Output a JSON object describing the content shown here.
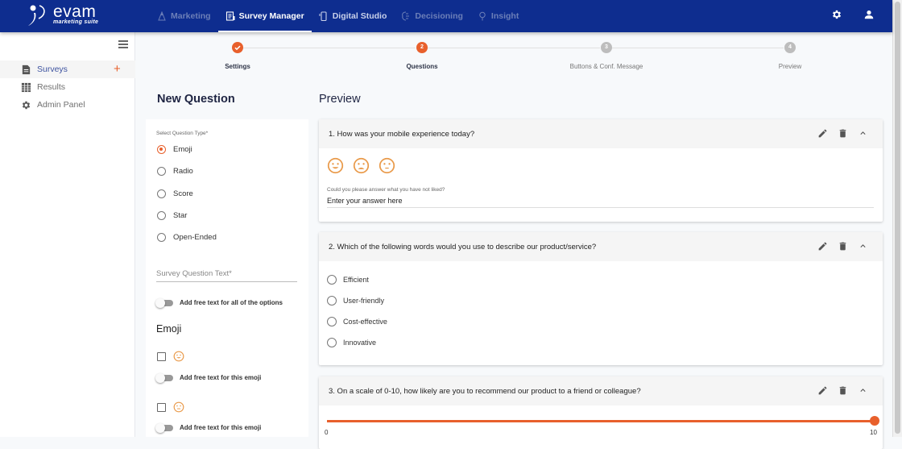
{
  "brand": {
    "name": "evam",
    "tagline": "marketing suite"
  },
  "nav": [
    {
      "label": "Marketing",
      "icon": "marketing-icon",
      "active": false
    },
    {
      "label": "Survey Manager",
      "icon": "survey-icon",
      "active": true
    },
    {
      "label": "Digital Studio",
      "icon": "mobile-icon",
      "active": false
    },
    {
      "label": "Decisioning",
      "icon": "brain-icon",
      "active": false
    },
    {
      "label": "Insight",
      "icon": "bulb-icon",
      "active": false
    }
  ],
  "sidebar": {
    "items": [
      {
        "label": "Surveys",
        "icon": "document-icon",
        "active": true
      },
      {
        "label": "Results",
        "icon": "table-icon",
        "active": false
      },
      {
        "label": "Admin Panel",
        "icon": "gear-icon",
        "active": false
      }
    ],
    "add_symbol": "+"
  },
  "stepper": {
    "steps": [
      {
        "label": "Settings",
        "state": "done",
        "number": "1"
      },
      {
        "label": "Questions",
        "state": "current",
        "number": "2"
      },
      {
        "label": "Buttons & Conf. Message",
        "state": "todo",
        "number": "3"
      },
      {
        "label": "Preview",
        "state": "todo",
        "number": "4"
      }
    ]
  },
  "new_question": {
    "title": "New Question",
    "type_label": "Select Question Type*",
    "types": [
      "Emoji",
      "Radio",
      "Score",
      "Star",
      "Open-Ended"
    ],
    "selected_type": "Emoji",
    "question_text_placeholder": "Survey Question Text*",
    "free_text_all_label": "Add free text for all of the options",
    "emoji_section_title": "Emoji",
    "emoji_options": [
      {
        "emoji": "happy",
        "free_text_label": "Add free text for this emoji"
      },
      {
        "emoji": "neutral",
        "free_text_label": "Add free text for this emoji"
      }
    ]
  },
  "preview": {
    "title": "Preview",
    "questions": [
      {
        "text": "1. How was your mobile experience today?",
        "type": "emoji",
        "emojis": [
          "happy",
          "sad",
          "neutral"
        ],
        "free_text_label": "Could you please answer what you have not liked?",
        "free_text_value": "Enter your answer here"
      },
      {
        "text": "2. Which of the following words would you use to describe our product/service?",
        "type": "radio",
        "options": [
          "Efficient",
          "User-friendly",
          "Cost-effective",
          "Innovative"
        ]
      },
      {
        "text": "3. On a scale of 0-10, how likely are you to recommend our product to a friend or colleague?",
        "type": "score",
        "min": "0",
        "max": "10",
        "value": 10
      }
    ]
  },
  "colors": {
    "brand": "#0e2d8f",
    "accent": "#e8602c",
    "emoji": "#e99a4a"
  }
}
